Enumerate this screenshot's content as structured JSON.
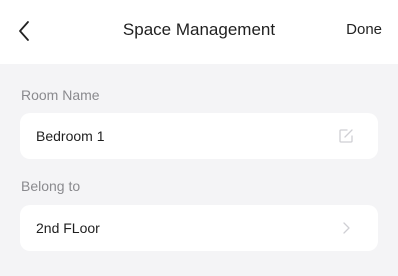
{
  "header": {
    "back_icon": "chevron-left-icon",
    "title": "Space Management",
    "done_label": "Done"
  },
  "room_name": {
    "label": "Room Name",
    "value": "Bedroom 1",
    "edit_icon": "edit-icon"
  },
  "belong_to": {
    "label": "Belong to",
    "value": "2nd FLoor",
    "chevron_icon": "chevron-right-icon"
  },
  "colors": {
    "background": "#f4f4f6",
    "card": "#ffffff",
    "label": "#8a8a8e",
    "icon": "#cfcfd4"
  }
}
